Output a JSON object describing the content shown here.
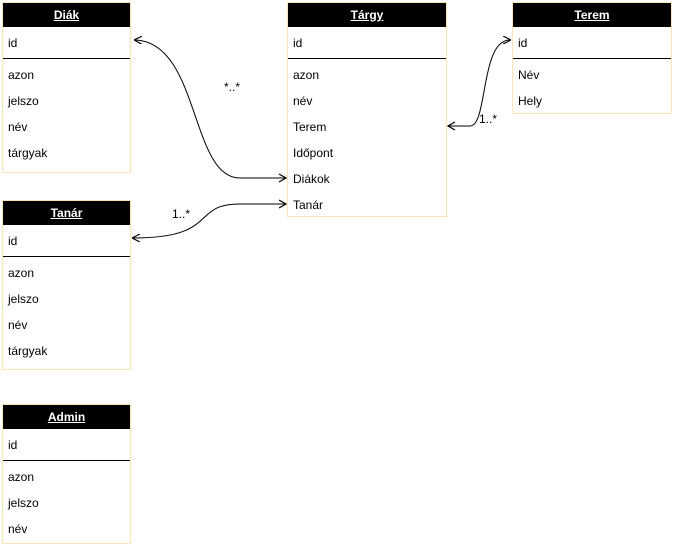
{
  "entities": {
    "diak": {
      "title": "Diák",
      "key": "id",
      "fields": [
        "azon",
        "jelszo",
        "név",
        "tárgyak"
      ]
    },
    "targy": {
      "title": "Tárgy",
      "key": "id",
      "fields": [
        "azon",
        "név",
        "Terem",
        "Időpont",
        "Diákok",
        "Tanár"
      ]
    },
    "terem": {
      "title": "Terem",
      "key": "id",
      "fields": [
        "Név",
        "Hely"
      ]
    },
    "tanar": {
      "title": "Tanár",
      "key": "id",
      "fields": [
        "azon",
        "jelszo",
        "név",
        "tárgyak"
      ]
    },
    "admin": {
      "title": "Admin",
      "key": "id",
      "fields": [
        "azon",
        "jelszo",
        "név"
      ]
    }
  },
  "relations": [
    {
      "from": "Tárgy.Diákok",
      "to": "Diák.id",
      "multiplicity": "*..*"
    },
    {
      "from": "Tárgy.Terem",
      "to": "Terem.id",
      "multiplicity": "1..*"
    },
    {
      "from": "Tárgy.Tanár",
      "to": "Tanár.id",
      "multiplicity": "1..*"
    }
  ],
  "colors": {
    "header": "#000000",
    "border": "#fbe4b5",
    "line": "#000000"
  }
}
